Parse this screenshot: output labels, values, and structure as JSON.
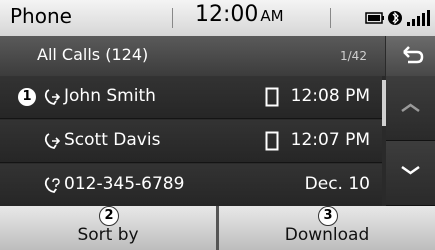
{
  "status": {
    "app": "Phone",
    "time": "12:00",
    "ampm": "AM"
  },
  "header": {
    "title": "All Calls (124)",
    "page": "1/42"
  },
  "calls": [
    {
      "name": "John Smith",
      "when": "12:08 PM",
      "type": "outgoing",
      "device": "mobile"
    },
    {
      "name": "Scott Davis",
      "when": "12:07 PM",
      "type": "outgoing",
      "device": "mobile"
    },
    {
      "name": "012-345-6789",
      "when": "Dec. 10",
      "type": "missed",
      "device": ""
    }
  ],
  "callouts": {
    "first": "1",
    "second": "2",
    "third": "3"
  },
  "buttons": {
    "sort": "Sort by",
    "download": "Download"
  },
  "icons": {
    "back": "back-arrow-icon",
    "up": "chevron-up-icon",
    "down": "chevron-down-icon",
    "call_out": "outgoing-call-icon",
    "call_missed": "missed-call-icon",
    "mobile": "mobile-phone-icon",
    "battery": "battery-icon",
    "bluetooth": "bluetooth-icon",
    "signal": "signal-icon"
  },
  "colors": {
    "status_bg": "#e6e6e6",
    "header_bg": "#4a4a4a",
    "list_bg": "#2b2b2b",
    "button_bg": "#d4d4d4"
  }
}
